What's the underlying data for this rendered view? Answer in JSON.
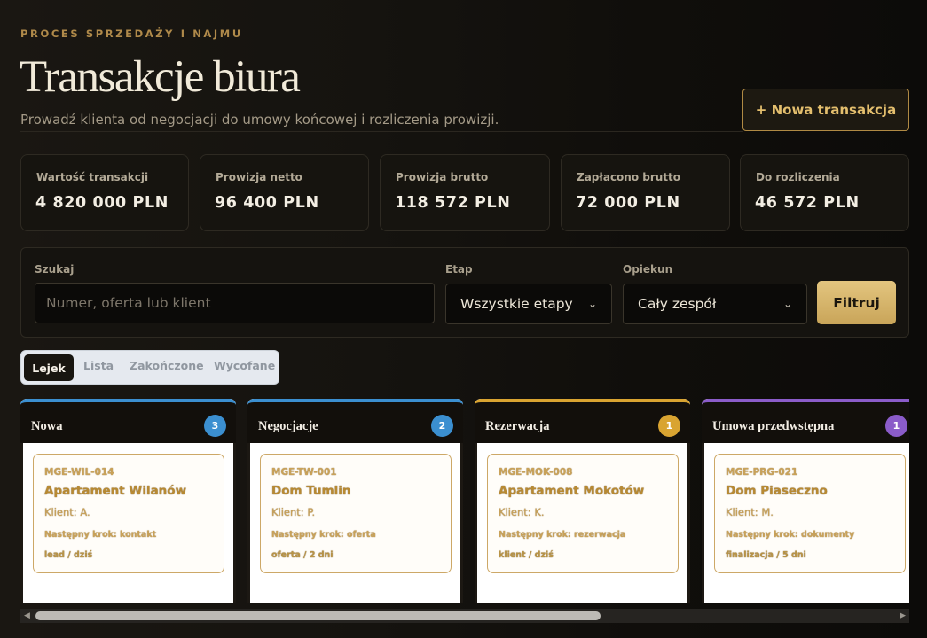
{
  "header": {
    "eyebrow": "PROCES SPRZEDAŻY I NAJMU",
    "title": "Transakcje biura",
    "subtitle": "Prowadź klienta od negocjacji do umowy końcowej i rozliczenia prowizji.",
    "new_button": "+ Nowa transakcja"
  },
  "stats": [
    {
      "label": "Wartość transakcji",
      "value": "4 820 000 PLN"
    },
    {
      "label": "Prowizja netto",
      "value": "96 400 PLN"
    },
    {
      "label": "Prowizja brutto",
      "value": "118 572 PLN"
    },
    {
      "label": "Zapłacono brutto",
      "value": "72 000 PLN"
    },
    {
      "label": "Do rozliczenia",
      "value": "46 572 PLN"
    }
  ],
  "filters": {
    "search_label": "Szukaj",
    "search_placeholder": "Numer, oferta lub klient",
    "stage_label": "Etap",
    "stage_value": "Wszystkie etapy",
    "owner_label": "Opiekun",
    "owner_value": "Cały zespół",
    "filter_button": "Filtruj"
  },
  "tabs": [
    {
      "label": "Lejek",
      "active": true
    },
    {
      "label": "Lista",
      "active": false
    },
    {
      "label": "Zakończone",
      "active": false
    },
    {
      "label": "Wycofane",
      "active": false
    }
  ],
  "columns": [
    {
      "title": "Nowa",
      "count": "3",
      "color": "#3b8fd0",
      "card": {
        "id": "MGE-WIL-014",
        "name": "Apartament Wilanów",
        "client": "Klient: A.",
        "next": "Następny krok: kontakt",
        "meta": "lead / dziś"
      }
    },
    {
      "title": "Negocjacje",
      "count": "2",
      "color": "#3b8fd0",
      "card": {
        "id": "MGE-TW-001",
        "name": "Dom Tumlin",
        "client": "Klient: P.",
        "next": "Następny krok: oferta",
        "meta": "oferta / 2 dni"
      }
    },
    {
      "title": "Rezerwacja",
      "count": "1",
      "color": "#d9a431",
      "card": {
        "id": "MGE-MOK-008",
        "name": "Apartament Mokotów",
        "client": "Klient: K.",
        "next": "Następny krok: rezerwacja",
        "meta": "klient / dziś"
      }
    },
    {
      "title": "Umowa przedwstępna",
      "count": "1",
      "color": "#8b5cc9",
      "card": {
        "id": "MGE-PRG-021",
        "name": "Dom Piaseczno",
        "client": "Klient: M.",
        "next": "Następny krok: dokumenty",
        "meta": "finalizacja / 5 dni"
      }
    }
  ],
  "scrollbar": {
    "left_arrow": "◀",
    "right_arrow": "▶"
  }
}
